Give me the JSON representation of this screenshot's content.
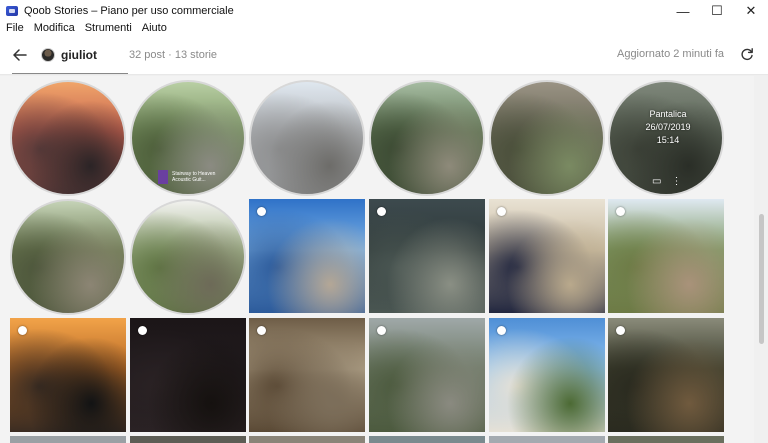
{
  "window": {
    "title": "Qoob Stories – Piano per uso commerciale",
    "minimize": "—",
    "maximize": "☐",
    "close": "✕"
  },
  "menu": [
    "File",
    "Modifica",
    "Strumenti",
    "Aiuto"
  ],
  "toolbar": {
    "username": "giuliot",
    "counts": "32 post · 13 storie",
    "updated": "Aggiornato 2 minuti fa"
  },
  "stories": [
    {
      "name": "story-1",
      "colors": [
        "#f0a56a",
        "#c4604e",
        "#5a3b3a",
        "#2b2426"
      ]
    },
    {
      "name": "story-2",
      "colors": [
        "#b9cfa4",
        "#7a9463",
        "#4d5e3a",
        "#8b8b82"
      ],
      "caption": {
        "thumb_color": "#6a3fa0",
        "text": "Stairway to Heaven Acoustic Guit..."
      }
    },
    {
      "name": "story-3",
      "colors": [
        "#dfe7ef",
        "#b6b9bd",
        "#8e8f90",
        "#6d6c69"
      ]
    },
    {
      "name": "story-4",
      "colors": [
        "#a6bca2",
        "#5e7452",
        "#3c4a33",
        "#8e8a7a"
      ]
    },
    {
      "name": "story-5",
      "colors": [
        "#9a9384",
        "#6c6a5a",
        "#4a4f3a",
        "#7a8a62"
      ]
    },
    {
      "name": "story-6",
      "colors": [
        "#7e877a",
        "#5c6558",
        "#3d4238",
        "#2a2e27"
      ],
      "overlay": {
        "place": "Pantalica",
        "date": "26/07/2019",
        "time": "15:14"
      }
    },
    {
      "name": "story-7",
      "colors": [
        "#c5d3b7",
        "#6f7d54",
        "#4d563b",
        "#8c8574"
      ]
    },
    {
      "name": "story-8",
      "colors": [
        "#f1f1ee",
        "#a3b58c",
        "#5f7443",
        "#6d6a58"
      ]
    }
  ],
  "posts_row1": [
    {
      "name": "post-beach",
      "colors": [
        "#2f72c8",
        "#7ab0e4",
        "#2c5a9a",
        "#b4a796"
      ]
    },
    {
      "name": "post-ruins-dark",
      "colors": [
        "#3d4a4e",
        "#2f3a3a",
        "#4a5652",
        "#8a8f84"
      ]
    },
    {
      "name": "post-graduate",
      "colors": [
        "#e9e2d4",
        "#c7b99e",
        "#21263f",
        "#b9a98c"
      ]
    },
    {
      "name": "post-park",
      "colors": [
        "#dfe9f1",
        "#7f9a66",
        "#6d7a45",
        "#a9927a"
      ]
    }
  ],
  "posts_row2": [
    {
      "name": "post-sunset",
      "colors": [
        "#f2a349",
        "#b86a26",
        "#3a2c22",
        "#121314"
      ]
    },
    {
      "name": "post-night",
      "colors": [
        "#1c1618",
        "#201a1d",
        "#2a2224",
        "#15110f"
      ]
    },
    {
      "name": "post-soldier",
      "colors": [
        "#6e5d47",
        "#b2a389",
        "#5a4935",
        "#7c6e5a"
      ]
    },
    {
      "name": "post-avenue",
      "colors": [
        "#9fa8a8",
        "#6f7b68",
        "#4c5a3e",
        "#8a8a80"
      ]
    },
    {
      "name": "post-church",
      "colors": [
        "#4f8fd6",
        "#8dc1f0",
        "#e6e1d6",
        "#4c6a34"
      ]
    },
    {
      "name": "post-garden-night",
      "colors": [
        "#8a8b7a",
        "#3d3f2e",
        "#2a2a1f",
        "#705a3e"
      ]
    }
  ]
}
